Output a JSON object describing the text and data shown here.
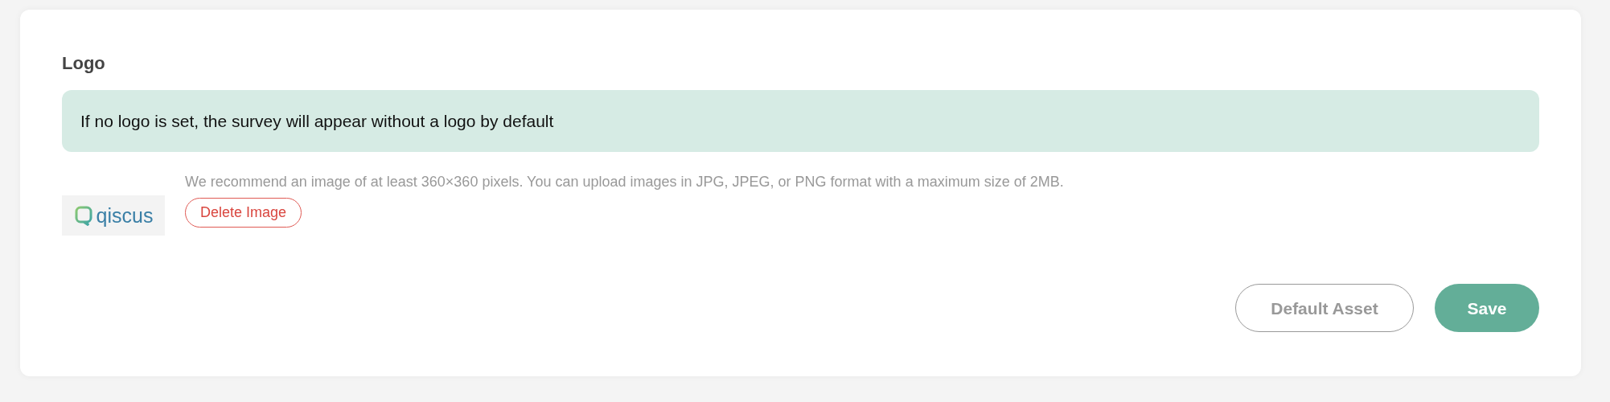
{
  "section": {
    "title": "Logo"
  },
  "info_alert": "If no logo is set, the survey will appear without a logo by default",
  "logo_preview": {
    "text": "qiscus"
  },
  "hint": "We recommend an image of at least 360×360 pixels. You can upload images in JPG, JPEG, or PNG format with a maximum size of 2MB.",
  "delete_button": "Delete Image",
  "buttons": [
    {
      "label": "Default Asset",
      "kind": "outline",
      "disabled": true
    },
    {
      "label": "Save",
      "kind": "primary",
      "disabled": false
    }
  ]
}
